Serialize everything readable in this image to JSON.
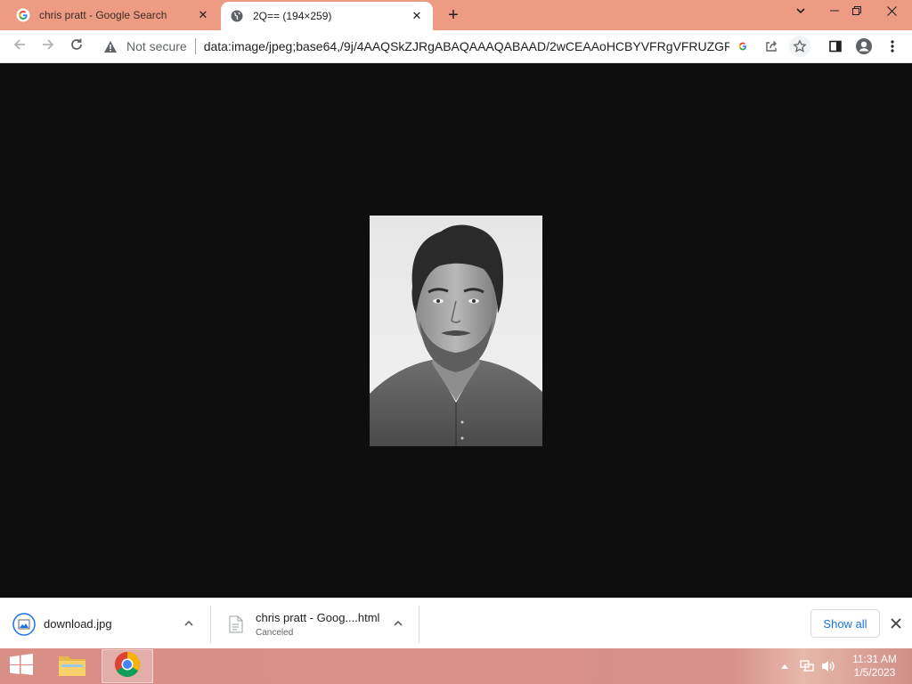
{
  "browser": {
    "tabs": [
      {
        "title": "chris pratt - Google Search",
        "favicon": "google-g-icon",
        "active": false
      },
      {
        "title": "2Q== (194×259)",
        "favicon": "globe-icon",
        "active": true
      }
    ],
    "new_tab_symbol": "+",
    "omnibox": {
      "security_label": "Not secure",
      "url": "data:image/jpeg;base64,/9j/4AAQSkZJRgABAQAAAQABAAD/2wCEAAoHCBYVFRgVFRUZGRga..."
    }
  },
  "image_viewer": {
    "image_width": 194,
    "image_height": 259,
    "description_icon": "portrait-photo"
  },
  "downloads": {
    "items": [
      {
        "name": "download.jpg",
        "status": "",
        "icon": "image-file-icon"
      },
      {
        "name": "chris pratt - Goog....html",
        "status": "Canceled",
        "icon": "document-file-icon"
      }
    ],
    "show_all_label": "Show all"
  },
  "taskbar": {
    "time": "11:31 AM",
    "date": "1/5/2023"
  },
  "colors": {
    "tabstrip": "#ed9c83",
    "viewer_background": "#0e0e0e",
    "link_blue": "#1a73e8"
  }
}
